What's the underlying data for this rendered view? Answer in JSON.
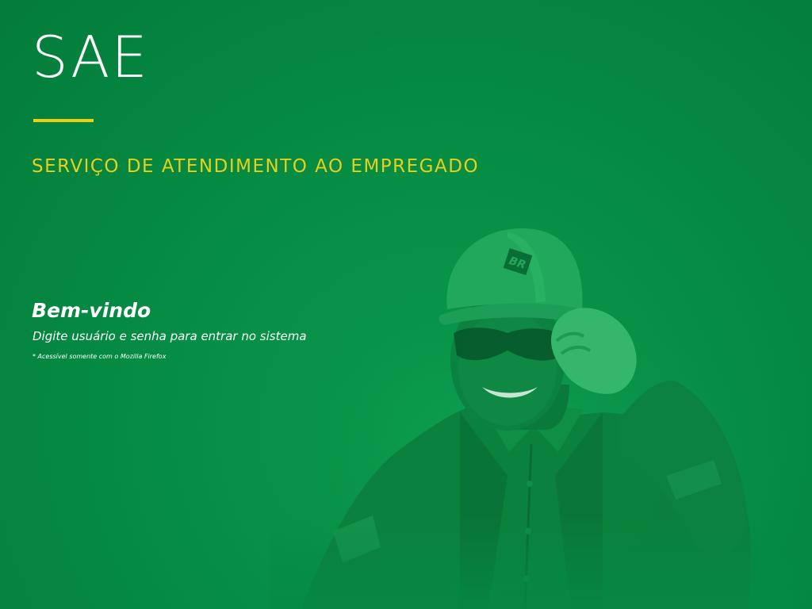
{
  "header": {
    "app_title": "SAE",
    "app_subtitle": "SERVIÇO DE ATENDIMENTO AO EMPREGADO"
  },
  "welcome": {
    "title": "Bem-vindo",
    "instructions": "Digite usuário e senha para entrar no sistema",
    "browser_note": "* Acessível somente com o Mozilla Firefox"
  },
  "hero": {
    "helmet_logo_text": "BR"
  },
  "colors": {
    "background": "#058a42",
    "accent_yellow": "#e8cf1a",
    "text_white": "#ffffff"
  }
}
